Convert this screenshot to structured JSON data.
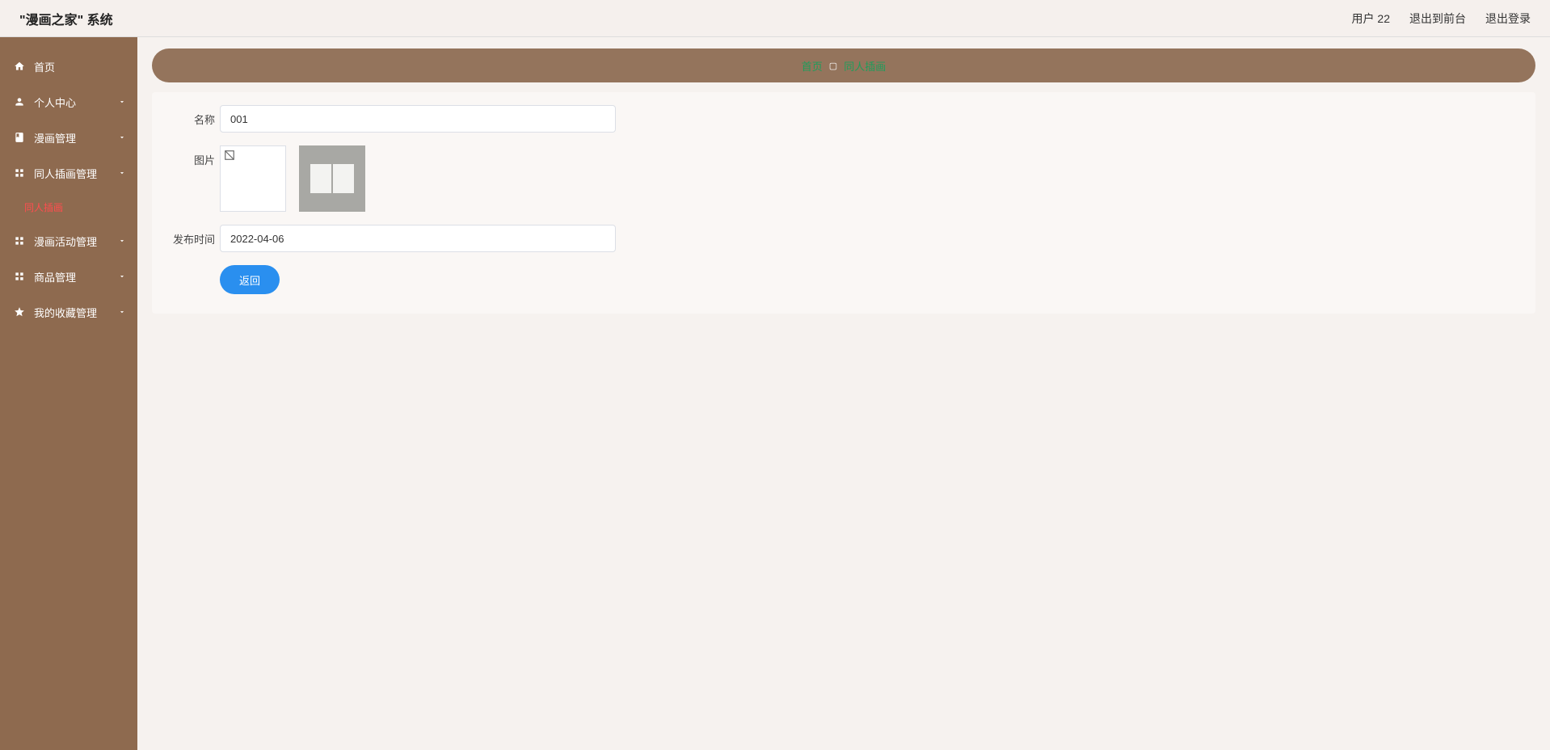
{
  "header": {
    "title": "\"漫画之家\" 系统",
    "user": "用户 22",
    "toFront": "退出到前台",
    "logout": "退出登录"
  },
  "sidebar": {
    "home": "首页",
    "items": [
      {
        "label": "个人中心"
      },
      {
        "label": "漫画管理"
      },
      {
        "label": "同人插画管理"
      },
      {
        "label": "漫画活动管理"
      },
      {
        "label": "商品管理"
      },
      {
        "label": "我的收藏管理"
      }
    ],
    "subActive": "同人插画"
  },
  "breadcrumb": {
    "home": "首页",
    "sep": "▢",
    "current": "同人插画"
  },
  "form": {
    "nameLabel": "名称",
    "nameValue": "001",
    "imageLabel": "图片",
    "publishLabel": "发布时间",
    "publishValue": "2022-04-06",
    "backBtn": "返回"
  }
}
